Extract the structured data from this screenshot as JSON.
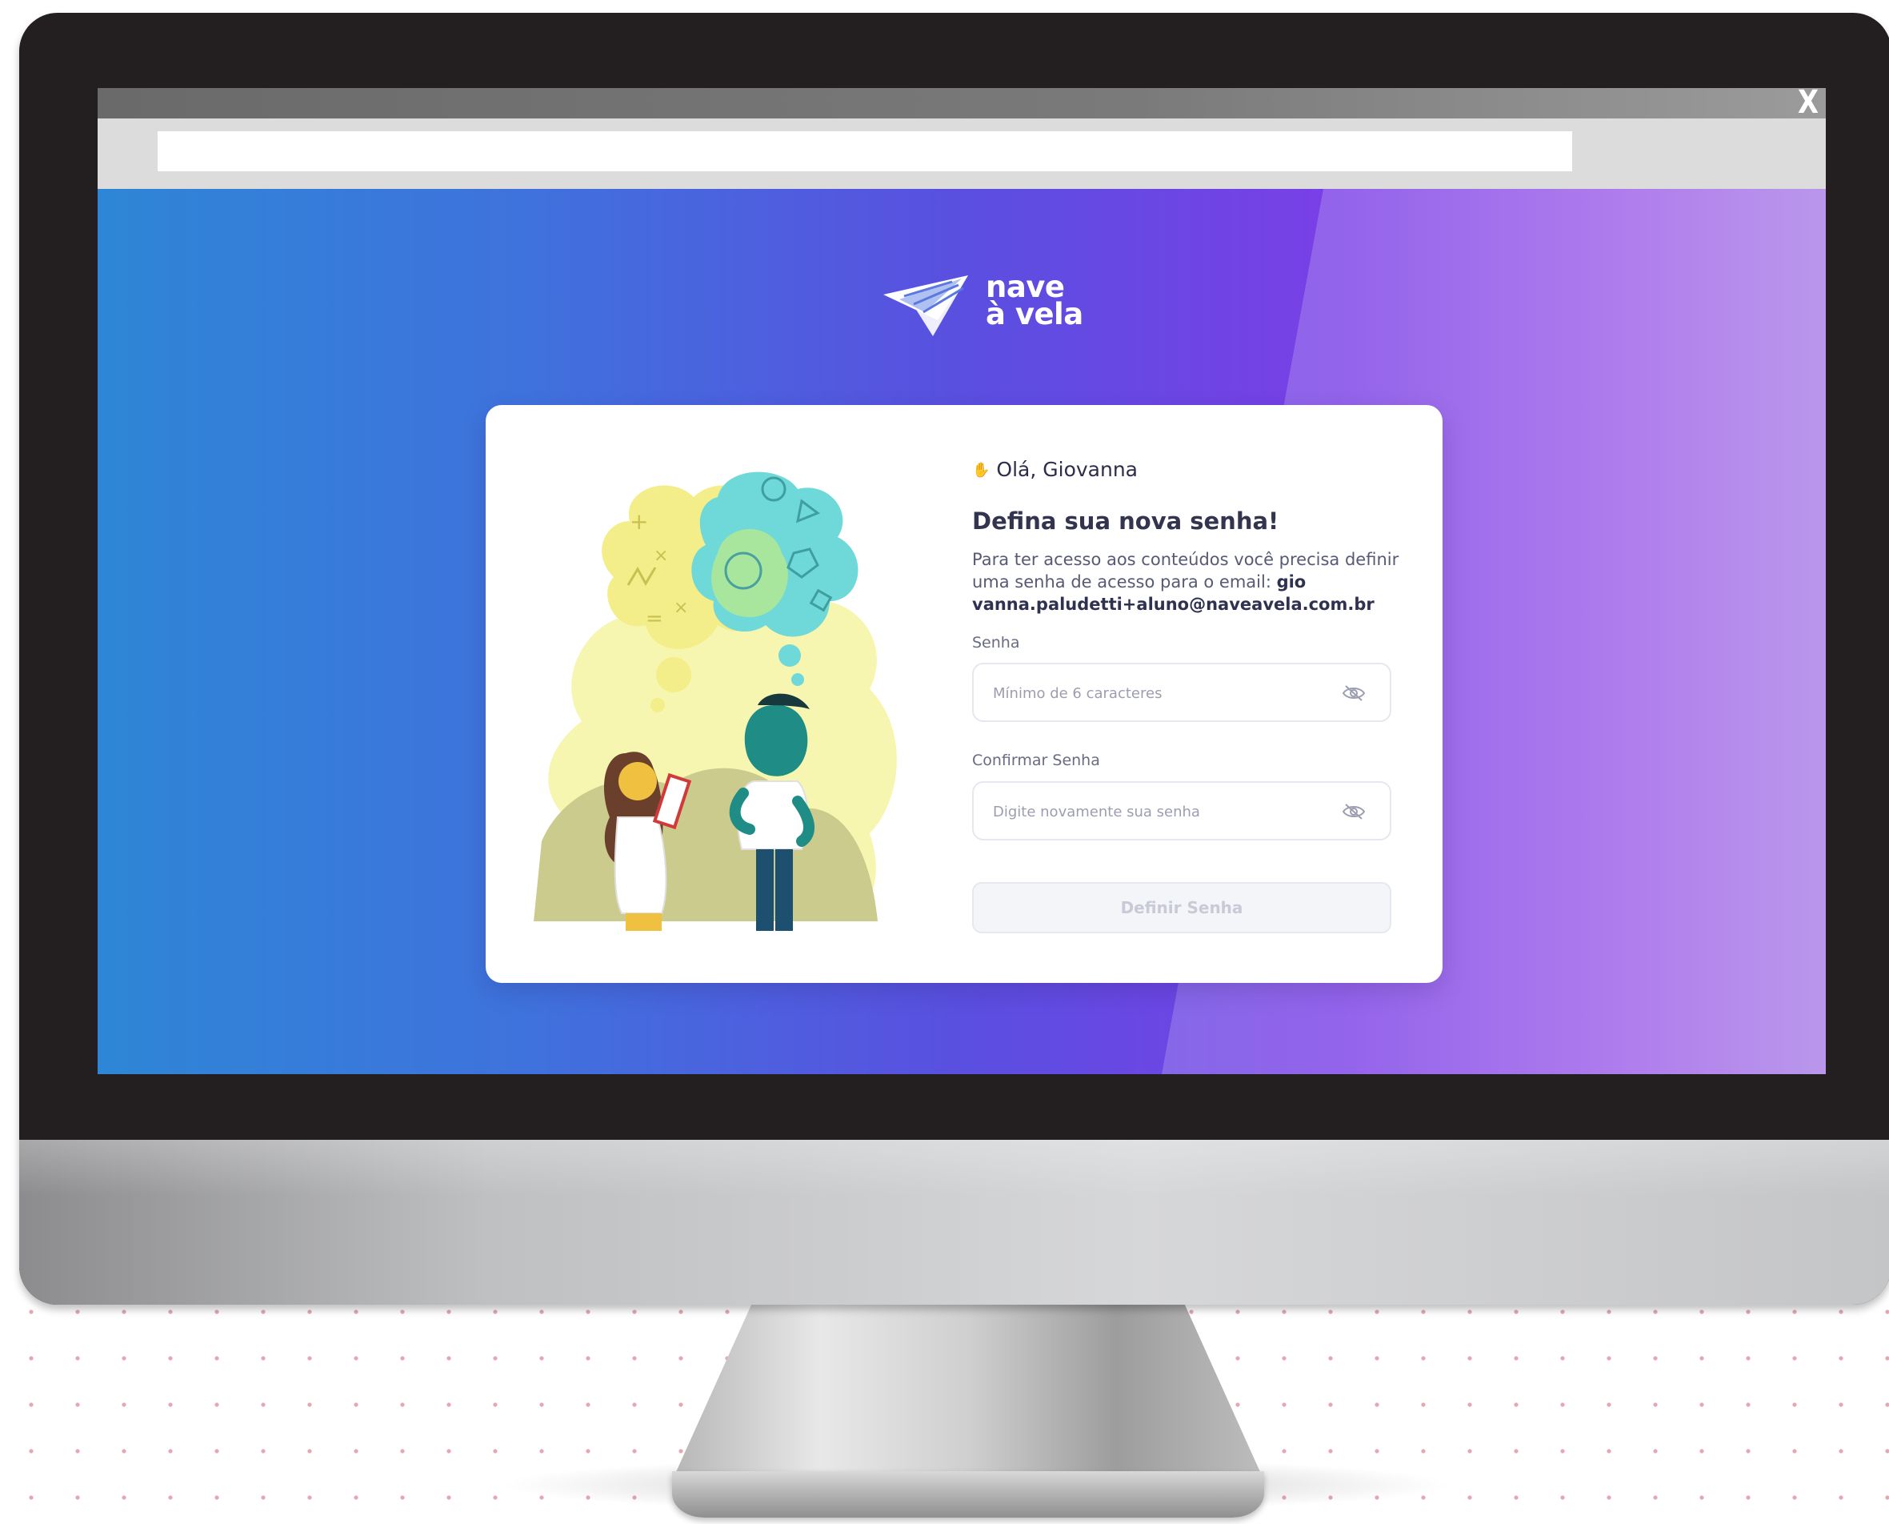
{
  "browser": {
    "close_label": "X",
    "address_value": ""
  },
  "logo": {
    "line1": "nave",
    "line2": "à vela",
    "icon": "paper-plane-icon"
  },
  "card": {
    "greeting": "Olá, Giovanna",
    "greeting_icon": "waving-hand-icon",
    "title": "Defina sua nova senha!",
    "description_prefix": "Para ter acesso aos conteúdos você precisa definir uma senha de acesso para o email: ",
    "description_email_part1": "gio",
    "description_email_part2": "vanna.paludetti+aluno@naveavela.com.br",
    "password_label": "Senha",
    "password_placeholder": "Mínimo de 6 caracteres",
    "confirm_label": "Confirmar Senha",
    "confirm_placeholder": "Digite novamente sua senha",
    "submit_label": "Definir Senha",
    "toggle_icon": "eye-off-icon"
  },
  "colors": {
    "gradient_left": "#2e86d6",
    "gradient_mid": "#5a4fe0",
    "gradient_right": "#a77ae6",
    "monitor_frame": "#231f20",
    "title_text": "#33344f"
  }
}
